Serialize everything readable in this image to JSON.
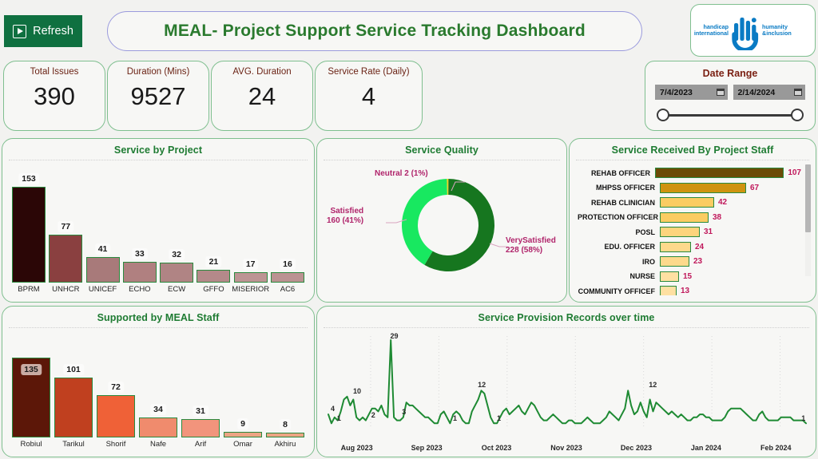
{
  "header": {
    "refresh_label": "Refresh",
    "refresh_icon": "play-triangle-icon",
    "title": "MEAL- Project Support Service Tracking Dashboard",
    "logo": {
      "name": "handicap-international-humanity-inclusion-logo",
      "left_line1": "handicap",
      "left_line2": "international",
      "mark": "Hi",
      "right_line1": "humanity",
      "right_line2": "&inclusion"
    }
  },
  "kpis": [
    {
      "label": "Total Issues",
      "value": "390"
    },
    {
      "label": "Duration (Mins)",
      "value": "9527"
    },
    {
      "label": "AVG. Duration",
      "value": "24"
    },
    {
      "label": "Service Rate (Daily)",
      "value": "4"
    }
  ],
  "date_range": {
    "title": "Date Range",
    "start": "7/4/2023",
    "end": "2/14/2024",
    "calendar_icon": "calendar-icon"
  },
  "panels": {
    "service_by_project": "Service by Project",
    "service_quality": "Service Quality",
    "service_received_by_staff": "Service Received By Project Staff",
    "supported_by_meal_staff": "Supported by MEAL Staff",
    "service_provision_over_time": "Service Provision Records over time"
  },
  "chart_data": [
    {
      "id": "service_by_project",
      "type": "bar",
      "title": "Service by Project",
      "orientation": "vertical",
      "categories": [
        "BPRM",
        "UNHCR",
        "UNICEF",
        "ECHO",
        "ECW",
        "GFFO",
        "MISERIOR",
        "AC6"
      ],
      "values": [
        153,
        77,
        41,
        33,
        32,
        21,
        17,
        16
      ],
      "colors": [
        "#2b0606",
        "#8a4040",
        "#a87a7a",
        "#b08080",
        "#b08484",
        "#b4898a",
        "#bd9494",
        "#bb9292"
      ],
      "bar_border": "#2a8a3e",
      "ylim": [
        0,
        153
      ],
      "xlabel": "",
      "ylabel": "",
      "grid": false,
      "legend": false
    },
    {
      "id": "service_quality",
      "type": "pie",
      "subtype": "donut",
      "title": "Service Quality",
      "labels": [
        "VerySatisfied",
        "Satisfied",
        "Neutral"
      ],
      "values": [
        228,
        160,
        2
      ],
      "percents": [
        "58%",
        "41%",
        "1%"
      ],
      "annotations": [
        "VerySatisfied 228 (58%)",
        "Satisfied 160 (41%)",
        "Neutral 2 (1%)"
      ],
      "colors": [
        "#16761f",
        "#18e860",
        "#f5d020"
      ],
      "label_color": "#b0246b",
      "legend": false
    },
    {
      "id": "service_received_by_project_staff",
      "type": "bar",
      "title": "Service Received By Project Staff",
      "orientation": "horizontal",
      "categories": [
        "REHAB OFFICER",
        "MHPSS OFFICER",
        "REHAB CLINICIAN",
        "PROTECTION OFFICER",
        "POSL",
        "EDU. OFFICER",
        "IRO",
        "NURSE",
        "COMMUNITY OFFICEF"
      ],
      "values": [
        107,
        67,
        42,
        38,
        31,
        24,
        23,
        15,
        13
      ],
      "colors": [
        "#6b4b06",
        "#cf9310",
        "#fbcc62",
        "#fbcc62",
        "#fdd47c",
        "#fdd98c",
        "#fdd98c",
        "#fee0a2",
        "#fee0a2"
      ],
      "bar_border": "#2a8a3e",
      "value_color": "#c0185b",
      "xlim": [
        0,
        107
      ],
      "grid": false,
      "legend": false,
      "scrollable": true
    },
    {
      "id": "supported_by_meal_staff",
      "type": "bar",
      "title": "Supported by MEAL Staff",
      "orientation": "vertical",
      "categories": [
        "Robiul",
        "Tarikul",
        "Shorif",
        "Nafe",
        "Arif",
        "Omar",
        "Akhiru"
      ],
      "values": [
        135,
        101,
        72,
        34,
        31,
        9,
        8
      ],
      "colors": [
        "#5c1708",
        "#c0401f",
        "#ef6137",
        "#f08b6d",
        "#f2947c",
        "#eda484",
        "#eda484"
      ],
      "bar_border": "#2a8a3e",
      "ylim": [
        0,
        135
      ],
      "grid": false,
      "legend": false
    },
    {
      "id": "service_provision_over_time",
      "type": "line",
      "title": "Service Provision Records over time",
      "xlabel": "",
      "ylabel": "",
      "line_color": "#1e8a33",
      "tick_labels": [
        "Aug 2023",
        "Sep 2023",
        "Oct 2023",
        "Nov 2023",
        "Dec 2023",
        "Jan 2024",
        "Feb 2024"
      ],
      "annotations": [
        {
          "label": "4",
          "x_frac": 0.022,
          "value": 4
        },
        {
          "label": "1",
          "x_frac": 0.035,
          "value": 1
        },
        {
          "label": "10",
          "x_frac": 0.072,
          "value": 10
        },
        {
          "label": "2",
          "x_frac": 0.105,
          "value": 2
        },
        {
          "label": "29",
          "x_frac": 0.148,
          "value": 29
        },
        {
          "label": "3",
          "x_frac": 0.168,
          "value": 3
        },
        {
          "label": "1",
          "x_frac": 0.272,
          "value": 1
        },
        {
          "label": "12",
          "x_frac": 0.327,
          "value": 12
        },
        {
          "label": "1",
          "x_frac": 0.362,
          "value": 1
        },
        {
          "label": "12",
          "x_frac": 0.677,
          "value": 12
        },
        {
          "label": "1",
          "x_frac": 0.985,
          "value": 1
        }
      ],
      "ylim": [
        0,
        29
      ],
      "values": [
        4,
        1,
        3,
        2,
        5,
        9,
        10,
        7,
        9,
        3,
        2,
        3,
        2,
        4,
        6,
        6,
        5,
        7,
        4,
        3,
        29,
        3,
        2,
        2,
        3,
        8,
        7,
        7,
        6,
        5,
        4,
        3,
        3,
        2,
        1,
        1,
        4,
        5,
        3,
        1,
        4,
        5,
        4,
        2,
        1,
        1,
        5,
        7,
        9,
        12,
        11,
        7,
        3,
        1,
        1,
        3,
        5,
        6,
        4,
        5,
        6,
        7,
        5,
        4,
        6,
        8,
        7,
        5,
        3,
        2,
        2,
        3,
        4,
        3,
        2,
        1,
        1,
        2,
        2,
        1,
        1,
        1,
        2,
        3,
        2,
        1,
        1,
        1,
        2,
        3,
        5,
        4,
        3,
        2,
        4,
        6,
        12,
        7,
        4,
        5,
        8,
        5,
        3,
        9,
        5,
        8,
        7,
        6,
        5,
        4,
        5,
        4,
        3,
        4,
        3,
        2,
        2,
        3,
        3,
        4,
        4,
        3,
        3,
        2,
        2,
        2,
        2,
        3,
        5,
        6,
        6,
        6,
        6,
        5,
        4,
        3,
        2,
        2,
        4,
        5,
        3,
        2,
        2,
        2,
        2,
        3,
        3,
        3,
        3,
        2,
        2,
        2,
        2,
        1
      ],
      "grid": "vertical-dotted"
    }
  ]
}
